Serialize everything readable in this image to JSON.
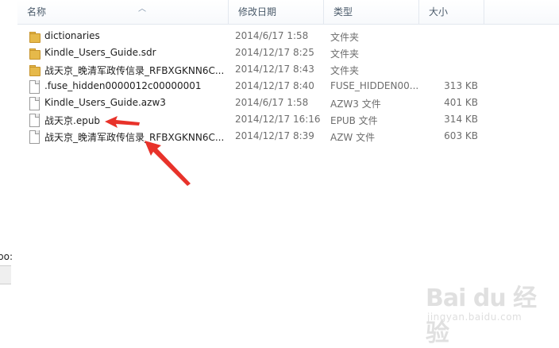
{
  "left_fragment": {
    "text": "po:"
  },
  "columns": {
    "name": "名称",
    "date": "修改日期",
    "type": "类型",
    "size": "大小"
  },
  "files": [
    {
      "kind": "folder",
      "name": "dictionaries",
      "date": "2014/6/17 1:58",
      "type": "文件夹",
      "size": ""
    },
    {
      "kind": "folder",
      "name": "Kindle_Users_Guide.sdr",
      "date": "2014/12/17 8:25",
      "type": "文件夹",
      "size": ""
    },
    {
      "kind": "folder",
      "name": "战天京_晚清军政传信录_RFBXGKNN6C...",
      "date": "2014/12/17 8:43",
      "type": "文件夹",
      "size": ""
    },
    {
      "kind": "file",
      "name": ".fuse_hidden0000012c00000001",
      "date": "2014/12/17 8:40",
      "type": "FUSE_HIDDEN00...",
      "size": "313 KB"
    },
    {
      "kind": "file",
      "name": "Kindle_Users_Guide.azw3",
      "date": "2014/6/17 1:58",
      "type": "AZW3 文件",
      "size": "401 KB"
    },
    {
      "kind": "file",
      "name": "战天京.epub",
      "date": "2014/12/17 16:16",
      "type": "EPUB 文件",
      "size": "314 KB"
    },
    {
      "kind": "file",
      "name": "战天京_晚清军政传信录_RFBXGKNN6C...",
      "date": "2014/12/17 8:39",
      "type": "AZW 文件",
      "size": "603 KB"
    }
  ],
  "annotation_color": "#e8322a",
  "watermark": {
    "brand": "Bai du 经验",
    "url": "jingyan.baidu.com"
  }
}
